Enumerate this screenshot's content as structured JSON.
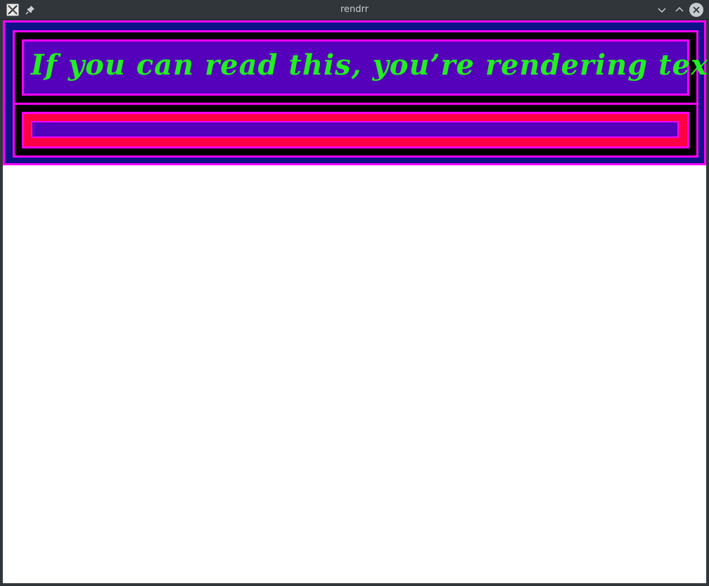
{
  "window": {
    "title": "rendrr",
    "icons": {
      "app": "x-app-icon",
      "pin": "pin-icon",
      "minimize": "chevron-down-icon",
      "maximize": "chevron-up-icon",
      "close": "close-icon"
    }
  },
  "content": {
    "headline": "If you can read this, you’re rendering text!",
    "input_value": ""
  },
  "colors": {
    "panel_background": "#0e1187",
    "border_magenta": "#ff00ff",
    "box_fill_purple": "#5500bb",
    "box_fill_black": "#000000",
    "box_fill_red": "#ff0044",
    "text_green": "#22ee22"
  }
}
